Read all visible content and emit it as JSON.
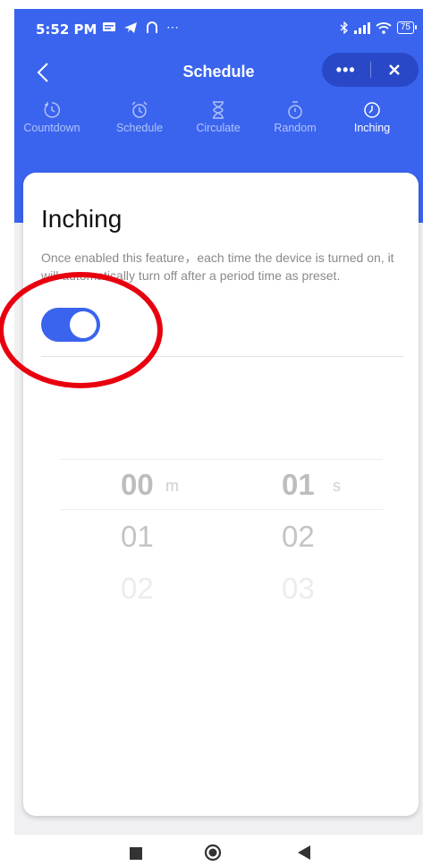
{
  "status_bar": {
    "time": "5:52 PM",
    "extra_icons": "⋯",
    "battery": "75"
  },
  "navbar": {
    "title": "Schedule",
    "more_label": "•••"
  },
  "tabs": [
    {
      "label": "Countdown",
      "icon": "countdown-icon",
      "active": false
    },
    {
      "label": "Schedule",
      "icon": "alarm-clock-icon",
      "active": false
    },
    {
      "label": "Circulate",
      "icon": "hourglass-icon",
      "active": false
    },
    {
      "label": "Random",
      "icon": "stopwatch-icon",
      "active": false
    },
    {
      "label": "Inching",
      "icon": "clock-icon",
      "active": true
    }
  ],
  "inching": {
    "title": "Inching",
    "description": "Once enabled this feature，each time the device is turned on, it will automatically turn off after a period time as preset.",
    "enabled": true
  },
  "picker": {
    "minutes": {
      "selected": "00",
      "unit": "m",
      "next": [
        "01",
        "02"
      ]
    },
    "seconds": {
      "selected": "01",
      "unit": "s",
      "next": [
        "02",
        "03"
      ]
    }
  },
  "colors": {
    "primary": "#3a64ee",
    "capsule": "#2948c7",
    "annotation": "#e8000f"
  }
}
